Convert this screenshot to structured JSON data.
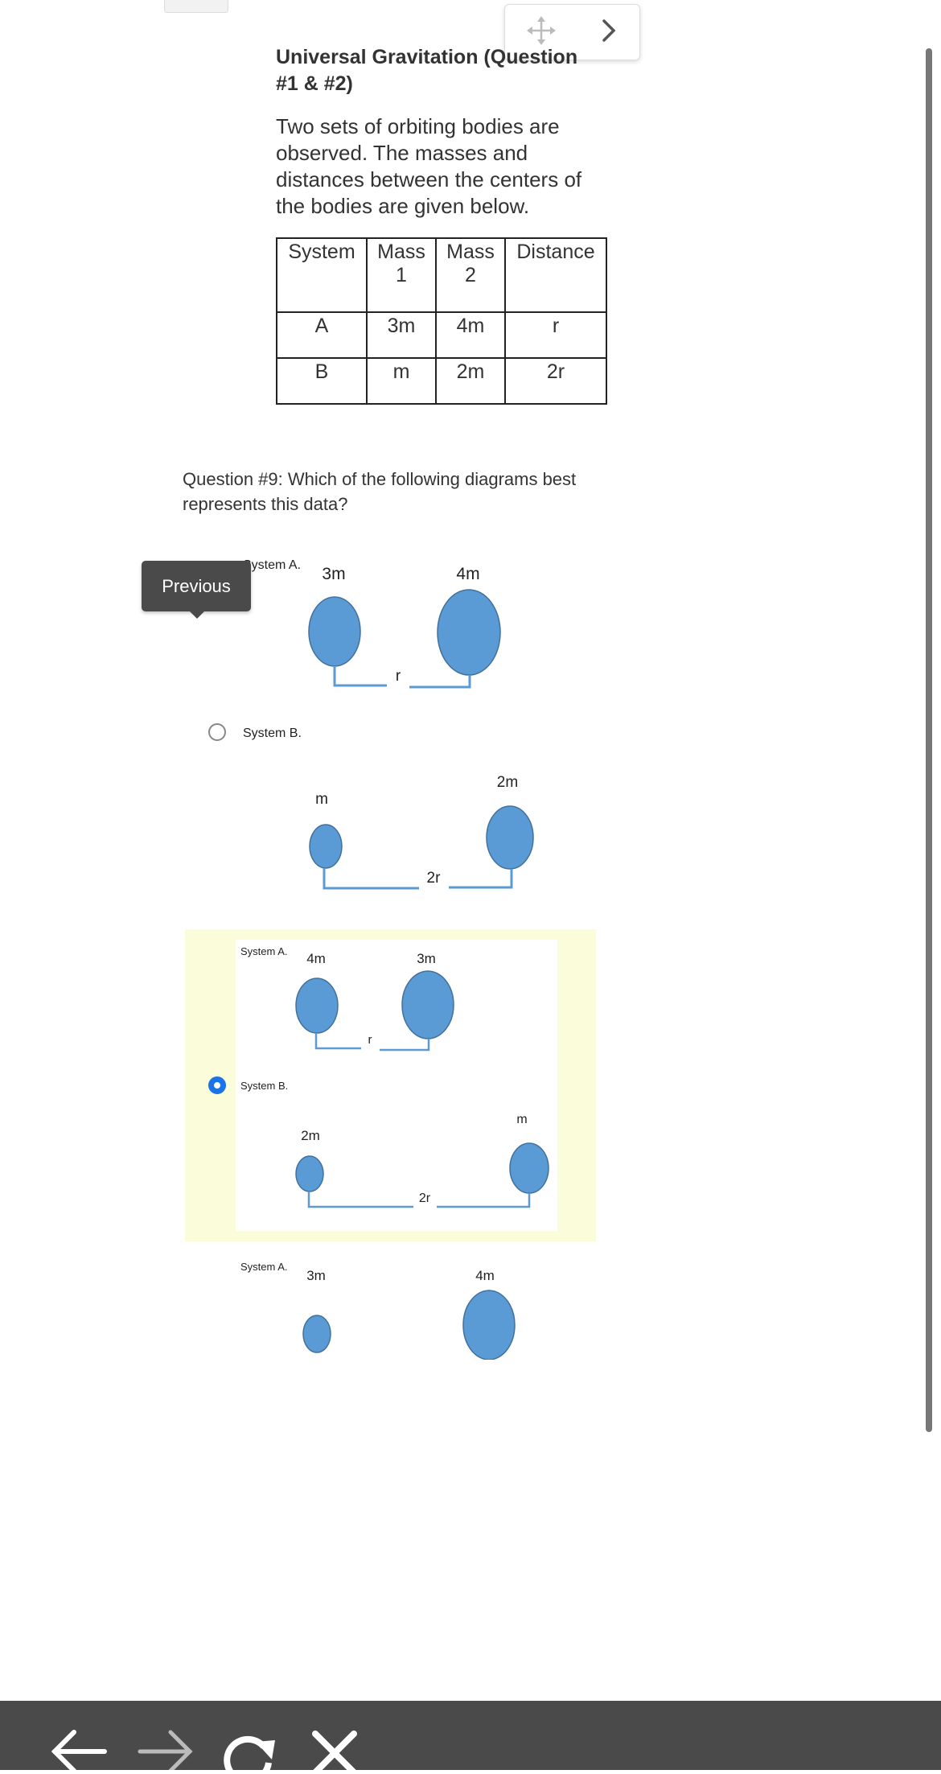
{
  "title": "Universal Gravitation (Question #1 & #2)",
  "intro": "Two sets of orbiting bodies are observed.  The masses and distances between the centers of the bodies are given below.",
  "table": {
    "headers": [
      "System",
      "Mass 1",
      "Mass 2",
      "Distance"
    ],
    "rows": [
      [
        "A",
        "3m",
        "4m",
        "r"
      ],
      [
        "B",
        "m",
        "2m",
        "2r"
      ]
    ]
  },
  "question": "Question #9:  Which of the following diagrams best represents this data?",
  "tooltip": "Previous",
  "options": [
    {
      "system_a_label": "System A.",
      "a_m1": "3m",
      "a_m2": "4m",
      "a_dist": "r",
      "system_b_label": "System B.",
      "b_m1": "m",
      "b_m2": "2m",
      "b_dist": "2r",
      "selected": false
    },
    {
      "system_a_label": "System A.",
      "a_m1": "4m",
      "a_m2": "3m",
      "a_dist": "r",
      "system_b_label": "System B.",
      "b_m1": "2m",
      "b_m2": "m",
      "b_dist": "2r",
      "selected": true
    },
    {
      "system_a_label": "System A.",
      "a_m1": "3m",
      "a_m2": "4m"
    }
  ],
  "icons": {
    "toolbox": [
      "move-icon",
      "chevron-right-icon"
    ],
    "bottom_nav": [
      "back-arrow-icon",
      "forward-arrow-icon",
      "reload-icon",
      "close-icon"
    ]
  },
  "colors": {
    "circle_fill": "#5b9bd5",
    "selected_highlight": "#fbfcd9",
    "radio_selected": "#1a73e8"
  }
}
